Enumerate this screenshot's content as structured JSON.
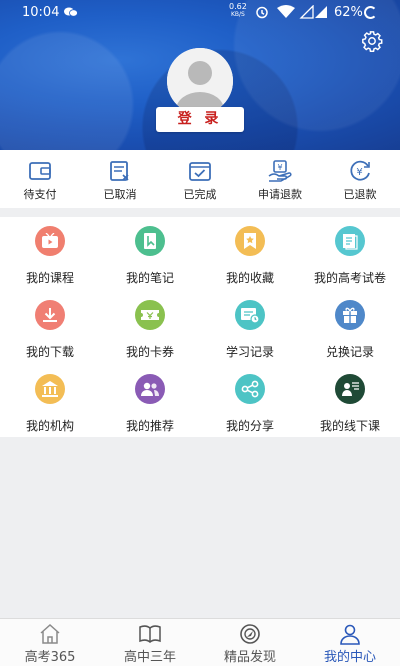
{
  "status_bar": {
    "time": "10:04",
    "speed_value": "0.62",
    "speed_unit": "KB/S",
    "battery": "62%"
  },
  "header": {
    "login_label": "登 录",
    "background_color": "#1f5fc7"
  },
  "orders": [
    {
      "label": "待支付",
      "icon": "wallet-icon"
    },
    {
      "label": "已取消",
      "icon": "cancelled-doc-icon"
    },
    {
      "label": "已完成",
      "icon": "completed-check-icon"
    },
    {
      "label": "申请退款",
      "icon": "refund-request-icon"
    },
    {
      "label": "已退款",
      "icon": "refunded-yen-icon"
    }
  ],
  "menu": [
    {
      "label": "我的课程",
      "icon": "play-tv-icon",
      "color": "#f07f6f"
    },
    {
      "label": "我的笔记",
      "icon": "notebook-icon",
      "color": "#4dbf8f"
    },
    {
      "label": "我的收藏",
      "icon": "star-bookmark-icon",
      "color": "#f3bd55"
    },
    {
      "label": "我的高考试卷",
      "icon": "exam-paper-icon",
      "color": "#56c7d0"
    },
    {
      "label": "我的下载",
      "icon": "download-icon",
      "color": "#f07f74"
    },
    {
      "label": "我的卡券",
      "icon": "coupon-icon",
      "color": "#8ac14f"
    },
    {
      "label": "学习记录",
      "icon": "study-record-icon",
      "color": "#4dc4c5"
    },
    {
      "label": "兑换记录",
      "icon": "exchange-gift-icon",
      "color": "#4f88c9"
    },
    {
      "label": "我的机构",
      "icon": "institution-icon",
      "color": "#f3bd55"
    },
    {
      "label": "我的推荐",
      "icon": "recommend-users-icon",
      "color": "#8a5bb5"
    },
    {
      "label": "我的分享",
      "icon": "share-icon",
      "color": "#4dc4c5"
    },
    {
      "label": "我的线下课",
      "icon": "offline-class-icon",
      "color": "#1f4a36"
    }
  ],
  "bottom_nav": [
    {
      "label": "高考365",
      "icon": "home-icon",
      "active": false
    },
    {
      "label": "高中三年",
      "icon": "book-icon",
      "active": false
    },
    {
      "label": "精品发现",
      "icon": "discover-icon",
      "active": false
    },
    {
      "label": "我的中心",
      "icon": "user-center-icon",
      "active": true
    }
  ],
  "colors": {
    "accent": "#2a58b9",
    "login_text": "#c8201e",
    "order_icon": "#3d6fb8"
  }
}
